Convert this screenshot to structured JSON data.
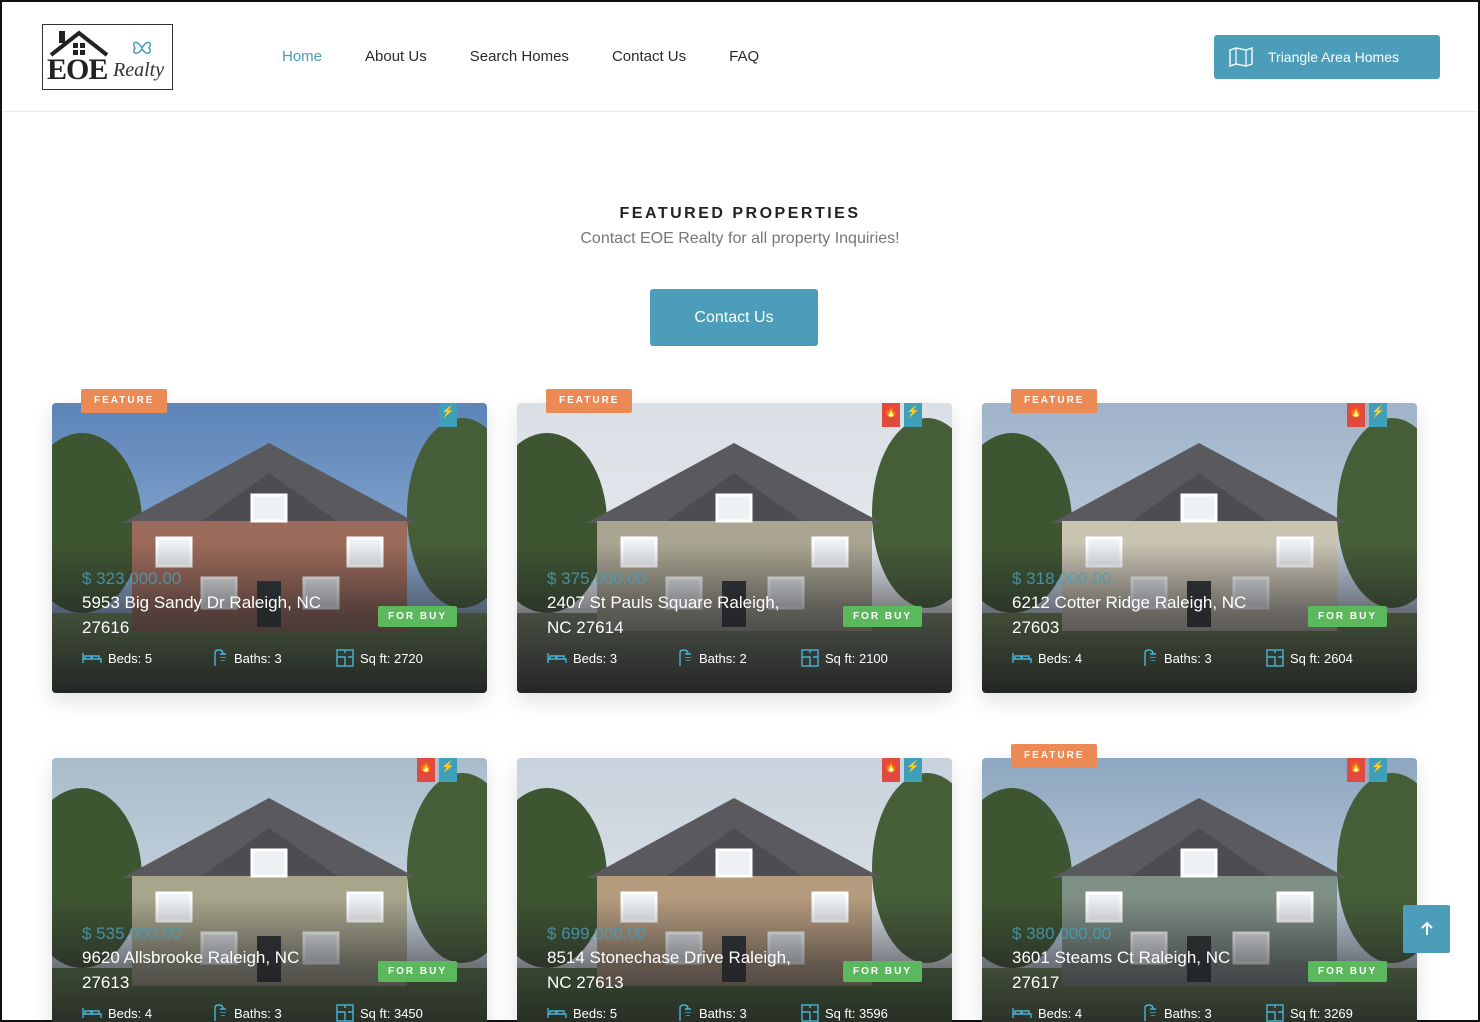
{
  "brand": {
    "logo_text": "EOE",
    "logo_script": "Realty"
  },
  "nav": {
    "items": [
      {
        "label": "Home",
        "active": true
      },
      {
        "label": "About Us",
        "active": false
      },
      {
        "label": "Search Homes",
        "active": false
      },
      {
        "label": "Contact Us",
        "active": false
      },
      {
        "label": "FAQ",
        "active": false
      }
    ],
    "cta_label": "Triangle Area Homes"
  },
  "section": {
    "title": "FEATURED PROPERTIES",
    "subtitle": "Contact EOE Realty for all property Inquiries!",
    "button_label": "Contact Us"
  },
  "colors": {
    "accent": "#4b9db9",
    "feature": "#ec8a55",
    "for_buy": "#5cb85c",
    "hot": "#e04a3f"
  },
  "properties": [
    {
      "feature": "FEATURE",
      "hot": false,
      "price": "$ 323,000.00",
      "address": "5953 Big Sandy Dr Raleigh, NC 27616",
      "status": "FOR BUY",
      "beds": "Beds: 5",
      "baths": "Baths: 3",
      "sqft": "Sq ft: 2720"
    },
    {
      "feature": "FEATURE",
      "hot": true,
      "price": "$ 375,000.00",
      "address": "2407 St Pauls Square Raleigh, NC 27614",
      "status": "FOR BUY",
      "beds": "Beds: 3",
      "baths": "Baths: 2",
      "sqft": "Sq ft: 2100"
    },
    {
      "feature": "FEATURE",
      "hot": true,
      "price": "$ 318,000.00",
      "address": "6212 Cotter Ridge Raleigh, NC 27603",
      "status": "FOR BUY",
      "beds": "Beds: 4",
      "baths": "Baths: 3",
      "sqft": "Sq ft: 2604"
    },
    {
      "feature": "",
      "hot": true,
      "price": "$ 535,000.00",
      "address": "9620 Allsbrooke Raleigh, NC 27613",
      "status": "FOR BUY",
      "beds": "Beds: 4",
      "baths": "Baths: 3",
      "sqft": "Sq ft: 3450"
    },
    {
      "feature": "",
      "hot": true,
      "price": "$ 699,000.00",
      "address": "8514 Stonechase Drive Raleigh, NC 27613",
      "status": "FOR BUY",
      "beds": "Beds: 5",
      "baths": "Baths: 3",
      "sqft": "Sq ft: 3596"
    },
    {
      "feature": "FEATURE",
      "hot": true,
      "price": "$ 380,000.00",
      "address": "3601 Steams Ct Raleigh, NC 27617",
      "status": "FOR BUY",
      "beds": "Beds: 4",
      "baths": "Baths: 3",
      "sqft": "Sq ft: 3269"
    }
  ],
  "icons": {
    "bed": "bed-icon",
    "bath": "shower-icon",
    "area": "floorplan-icon",
    "hot": "flame-icon",
    "new": "lightning-icon",
    "top": "arrow-up-icon"
  }
}
